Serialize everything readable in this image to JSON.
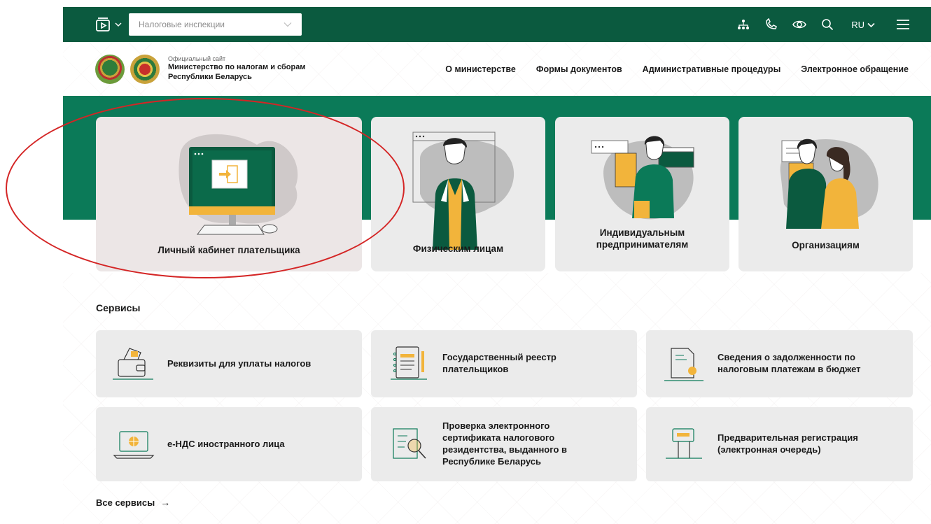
{
  "topbar": {
    "inspection_select": "Налоговые инспекции",
    "lang": "RU"
  },
  "header": {
    "site_sub": "Официальный сайт",
    "site_title_line1": "Министерство по налогам и сборам",
    "site_title_line2": "Республики Беларусь",
    "nav": [
      "О министерстве",
      "Формы документов",
      "Административные процедуры",
      "Электронное обращение"
    ]
  },
  "cards": {
    "cabinet": "Личный кабинет плательщика",
    "physical": "Физическим лицам",
    "ip_line1": "Индивидуальным",
    "ip_line2": "предпринимателям",
    "organizations": "Организациям"
  },
  "services": {
    "title": "Сервисы",
    "items": [
      {
        "line1": "Реквизиты для уплаты налогов",
        "line2": "",
        "line3": "",
        "line4": ""
      },
      {
        "line1": "Государственный реестр",
        "line2": "плательщиков",
        "line3": "",
        "line4": ""
      },
      {
        "line1": "Сведения о задолженности по",
        "line2": "налоговым платежам в бюджет",
        "line3": "",
        "line4": ""
      },
      {
        "line1": "е-НДС иностранного лица",
        "line2": "",
        "line3": "",
        "line4": ""
      },
      {
        "line1": "Проверка электронного",
        "line2": "сертификата налогового",
        "line3": "резидентства, выданного в",
        "line4": "Республике Беларусь"
      },
      {
        "line1": "Предварительная регистрация",
        "line2": "(электронная очередь)",
        "line3": "",
        "line4": ""
      }
    ],
    "all_label": "Все сервисы",
    "all_arrow": "→"
  },
  "colors": {
    "dark_green": "#0b5a3f",
    "band_green": "#0b7a58",
    "accent_yellow": "#f2b43b",
    "highlight_red": "#d42525"
  }
}
